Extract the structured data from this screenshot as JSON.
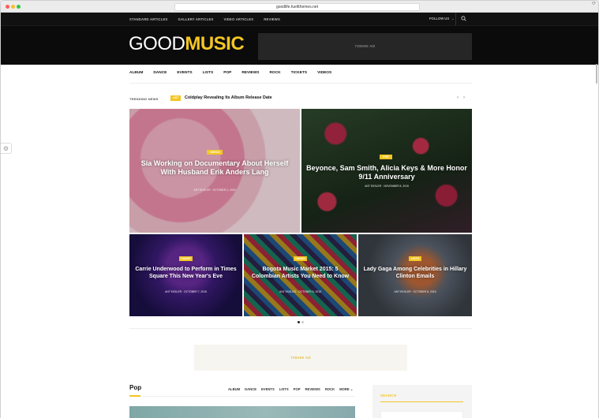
{
  "browser": {
    "url": "goodlife.fueltthemes.net"
  },
  "topbar": {
    "links": [
      "STANDARD ARTICLES",
      "GALLERY ARTICLES",
      "VIDEO ARTICLES",
      "REVIEWS"
    ],
    "follow": "FOLLOW US"
  },
  "logo": {
    "good": "GOOD",
    "music": "MUSIC"
  },
  "header_ad": "728X90 AD",
  "mainnav": [
    "ALBUM",
    "DANCE",
    "EVENTS",
    "LISTS",
    "POP",
    "REVIEWS",
    "ROCK",
    "TICKETS",
    "VIDEOS"
  ],
  "trending": {
    "label": "TRENDING NEWS",
    "badge": "LIST",
    "title": "Coldplay Revealing Its Album Release Date"
  },
  "featured": [
    {
      "category": "VIDEOS",
      "title": "Sia Working on Documentary About Herself With Husband Erik Anders Lang",
      "meta": "ANT EKSLER  ·  OCTOBER 2, 2015"
    },
    {
      "category": "POP",
      "title": "Beyonce, Sam Smith, Alicia Keys & More Honor 9/11 Anniversary",
      "meta": "ANT EKSLER  ·  NOVEMBER 8, 2015"
    },
    {
      "category": "DANCE",
      "title": "Carrie Underwood to Perform in Times Square This New Year's Eve",
      "meta": "ANT EKSLER  ·  OCTOBER 7, 2015"
    },
    {
      "category": "DANCE",
      "title": "Bogota Music Market 2015: 5 Colombian Artists You Need to Know",
      "meta": "ANT EKSLER  ·  OCTOBER 8, 2015"
    },
    {
      "category": "LISTS",
      "title": "Lady Gaga Among Celebrities in Hillary Clinton Emails",
      "meta": "ANT EKSLER  ·  OCTOBER 8, 2015"
    }
  ],
  "mid_ad": "728X90 AD",
  "pop_section": {
    "title": "Pop",
    "filters": [
      "ALBUM",
      "DANCE",
      "EVENTS",
      "LISTS",
      "POP",
      "REVIEWS",
      "ROCK",
      "MORE"
    ]
  },
  "sidebar": {
    "search_title": "SEARCH"
  }
}
